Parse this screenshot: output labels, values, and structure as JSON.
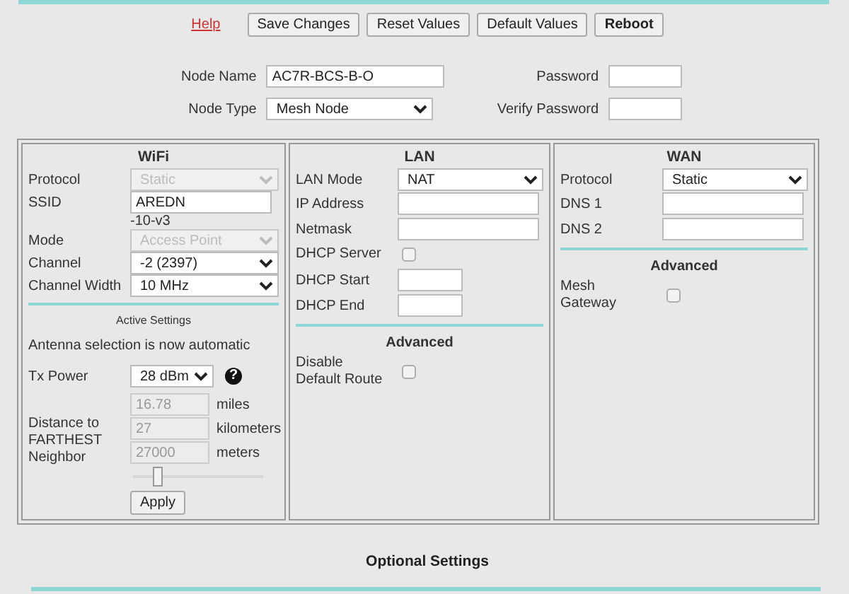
{
  "toolbar": {
    "help": "Help",
    "buttons": [
      {
        "label": "Save Changes",
        "bold": false
      },
      {
        "label": "Reset Values",
        "bold": false
      },
      {
        "label": "Default Values",
        "bold": false
      },
      {
        "label": "Reboot",
        "bold": true
      }
    ]
  },
  "node": [
    {
      "label": "Node Name",
      "kind": "text",
      "value": "AC7R-BCS-B-O"
    },
    {
      "label": "Password",
      "kind": "password"
    },
    {
      "label": "Node Type",
      "kind": "select",
      "value": "Mesh Node"
    },
    {
      "label": "Verify Password",
      "kind": "password"
    }
  ],
  "panels": [
    {
      "title": "WiFi",
      "items": [
        {
          "kind": "select",
          "label": "Protocol",
          "value": "Static",
          "disabled": true
        },
        {
          "kind": "ssid",
          "label": "SSID",
          "value": "AREDN",
          "suffix": "-10-v3"
        },
        {
          "kind": "select",
          "label": "Mode",
          "value": "Access Point",
          "disabled": true
        },
        {
          "kind": "select",
          "label": "Channel",
          "value": "-2 (2397)",
          "disabled": false
        },
        {
          "kind": "select",
          "label": "Channel Width",
          "value": "10 MHz",
          "disabled": false
        },
        {
          "kind": "divider"
        },
        {
          "kind": "subheading",
          "text": "Active Settings"
        },
        {
          "kind": "note",
          "text": "Antenna selection is now automatic"
        },
        {
          "kind": "tx-power",
          "label": "Tx Power",
          "value": "28 dBm",
          "help": "?"
        },
        {
          "kind": "distance",
          "label": "Distance to FARTHEST Neighbor",
          "fields": [
            {
              "value": "16.78",
              "unit": "miles",
              "disabled": true
            },
            {
              "value": "27",
              "unit": "kilometers",
              "disabled": true
            },
            {
              "value": "27000",
              "unit": "meters",
              "disabled": true
            }
          ]
        },
        {
          "kind": "slider",
          "level": 0.2
        },
        {
          "kind": "button",
          "label": "Apply"
        }
      ]
    },
    {
      "title": "LAN",
      "items": [
        {
          "kind": "select",
          "label": "LAN Mode",
          "value": "NAT",
          "disabled": false
        },
        {
          "kind": "text",
          "label": "IP Address"
        },
        {
          "kind": "text",
          "label": "Netmask"
        },
        {
          "kind": "checkbox",
          "label": "DHCP Server",
          "checked": false
        },
        {
          "kind": "short-text",
          "label": "DHCP Start"
        },
        {
          "kind": "short-text",
          "label": "DHCP End"
        },
        {
          "kind": "divider"
        },
        {
          "kind": "heading",
          "text": "Advanced"
        },
        {
          "kind": "checkbox",
          "label": "Disable Default Route",
          "checked": false
        }
      ]
    },
    {
      "title": "WAN",
      "items": [
        {
          "kind": "select",
          "label": "Protocol",
          "value": "Static",
          "disabled": false
        },
        {
          "kind": "text",
          "label": "DNS 1"
        },
        {
          "kind": "text",
          "label": "DNS 2"
        },
        {
          "kind": "divider"
        },
        {
          "kind": "heading",
          "text": "Advanced"
        },
        {
          "kind": "checkbox",
          "label": "Mesh Gateway",
          "checked": false
        }
      ]
    }
  ],
  "footer": {
    "title": "Optional Settings"
  }
}
